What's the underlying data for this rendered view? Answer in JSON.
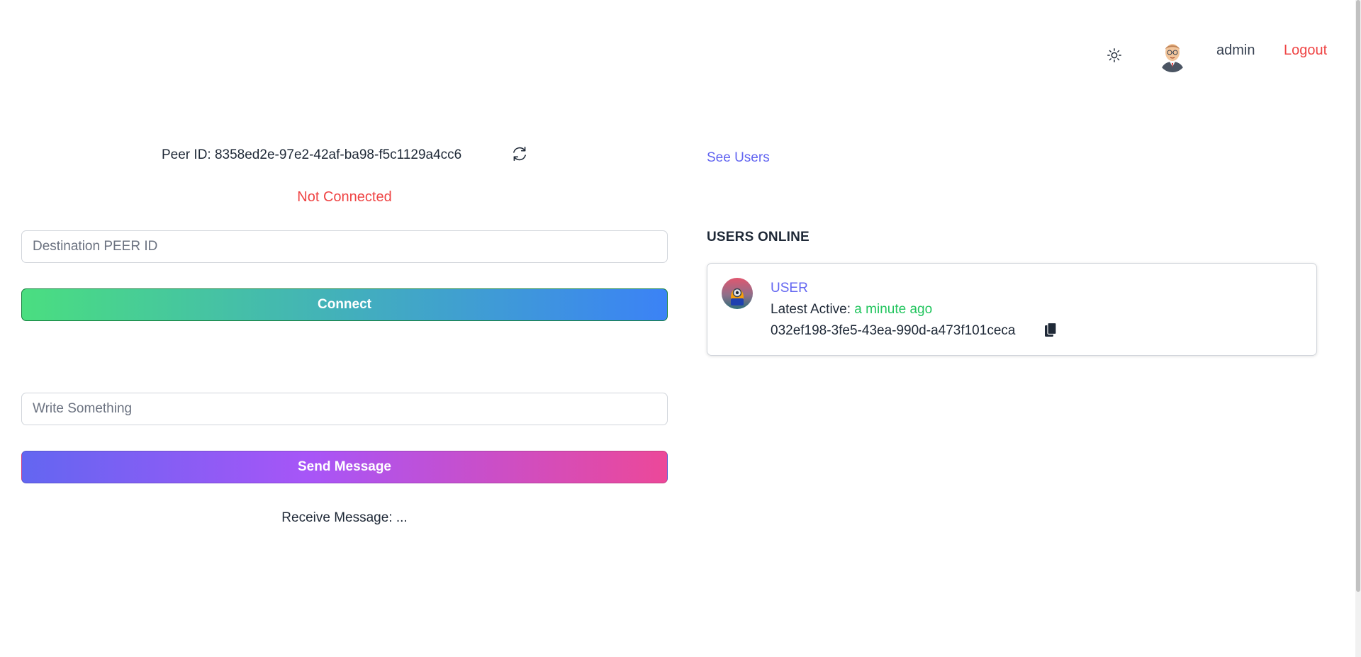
{
  "header": {
    "theme_icon": "sun-icon",
    "avatar_icon": "admin-avatar",
    "username": "admin",
    "logout_label": "Logout"
  },
  "peer": {
    "id_label": "Peer ID: 8358ed2e-97e2-42af-ba98-f5c1129a4cc6",
    "refresh_icon": "refresh-icon",
    "status": "Not Connected"
  },
  "connect_form": {
    "destination_placeholder": "Destination PEER ID",
    "destination_value": "",
    "connect_label": "Connect"
  },
  "message_form": {
    "message_placeholder": "Write Something",
    "message_value": "",
    "send_label": "Send Message",
    "receive_label": "Receive Message: ..."
  },
  "users": {
    "see_users_label": "See Users",
    "online_title": "USERS ONLINE",
    "list": [
      {
        "name": "USER",
        "active_prefix": "Latest Active: ",
        "active_ago": "a minute ago",
        "id": "032ef198-3fe5-43ea-990d-a473f101ceca",
        "copy_icon": "copy-icon"
      }
    ]
  },
  "colors": {
    "danger": "#ef4444",
    "link": "#6366f1",
    "success": "#22c55e",
    "connect_gradient": [
      "#4ade80",
      "#3b82f6"
    ],
    "send_gradient": [
      "#6366f1",
      "#a855f7",
      "#ec4899"
    ]
  }
}
